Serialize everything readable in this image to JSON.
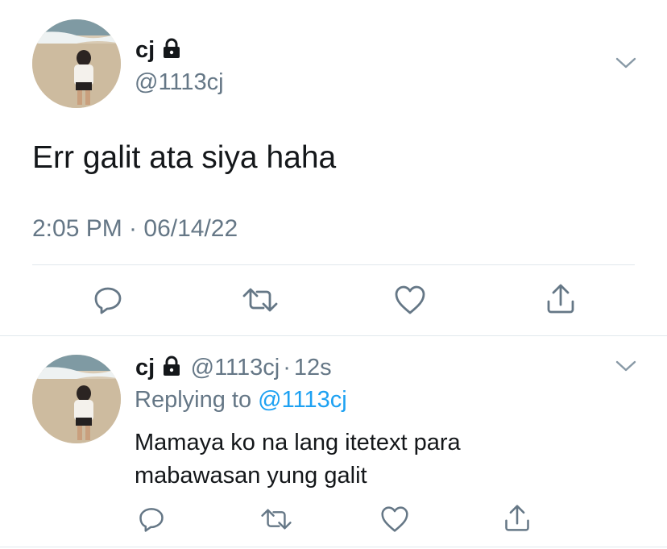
{
  "main_tweet": {
    "display_name": "cj",
    "handle": "@1113cj",
    "text": "Err galit ata siya haha",
    "timestamp": "2:05 PM · 06/14/22",
    "protected": true
  },
  "reply_tweet": {
    "display_name": "cj",
    "handle": "@1113cj",
    "separator": "·",
    "time_ago": "12s",
    "replying_prefix": "Replying to",
    "replying_to": "@1113cj",
    "text_line1": "Mamaya ko na lang itetext para",
    "text_line2": "mabawasan yung galit",
    "protected": true
  },
  "actions": [
    "reply-icon",
    "retweet-icon",
    "like-icon",
    "share-icon"
  ],
  "colors": {
    "text": "#14171a",
    "secondary": "#657786",
    "link": "#1da1f2",
    "divider": "#e1e8ed"
  }
}
